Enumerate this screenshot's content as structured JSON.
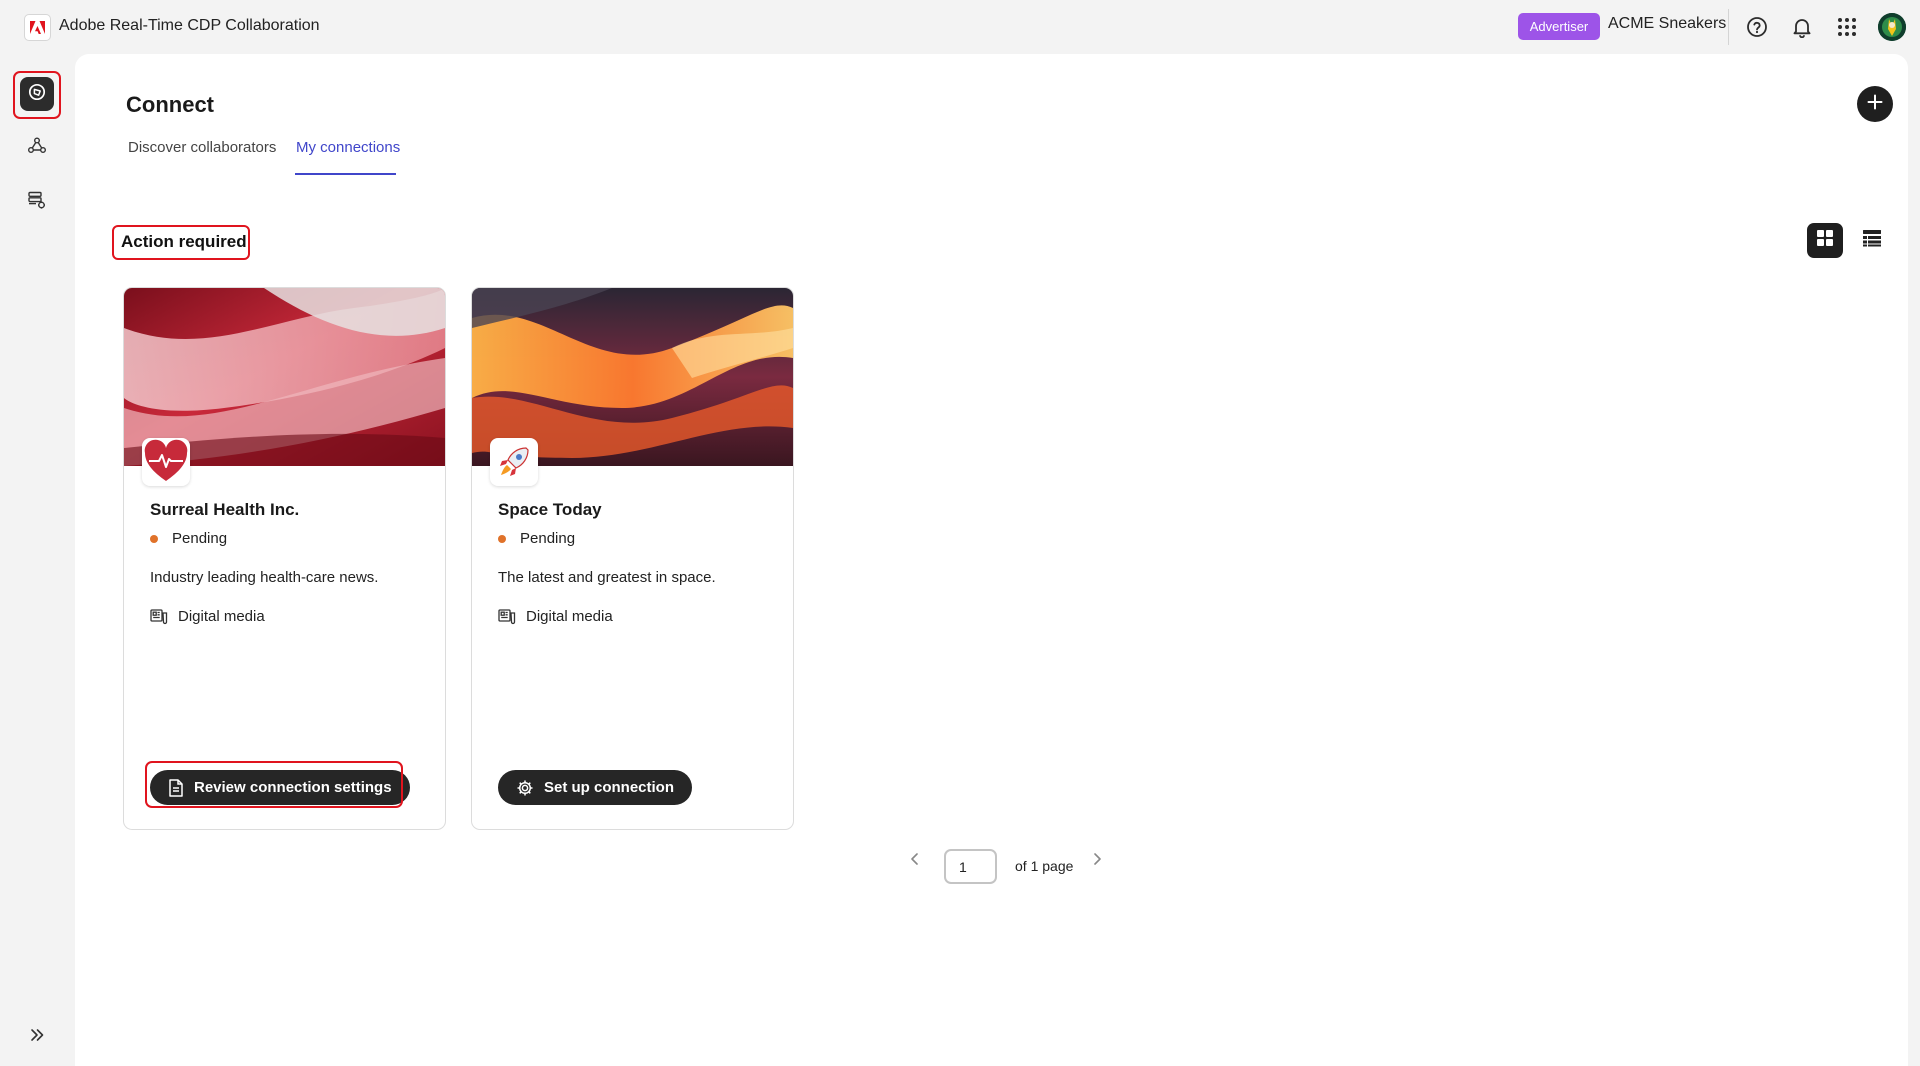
{
  "app": {
    "title": "Adobe Real-Time CDP Collaboration",
    "role_badge": "Advertiser",
    "org_name": "ACME Sneakers",
    "brand_color": "#e0141e"
  },
  "topbar": {
    "icons": [
      "help-icon",
      "bell-icon",
      "apps-grid-icon",
      "user-avatar"
    ]
  },
  "rail": {
    "items": [
      {
        "icon": "compass-icon",
        "active": true
      },
      {
        "icon": "collaborators-icon",
        "active": false
      },
      {
        "icon": "data-settings-icon",
        "active": false
      }
    ],
    "expand_icon": "expand-chevrons-icon"
  },
  "page": {
    "title": "Connect",
    "tabs": [
      {
        "label": "Discover collaborators",
        "selected": false
      },
      {
        "label": "My connections",
        "selected": true
      }
    ],
    "accent_color": "#4046ca"
  },
  "section": {
    "title": "Action required"
  },
  "cards": [
    {
      "name": "Surreal Health Inc.",
      "status": "Pending",
      "description": "Industry leading health-care news.",
      "category": "Digital media",
      "button": "Review connection settings",
      "logo_icon": "heart-pulse-icon"
    },
    {
      "name": "Space Today",
      "status": "Pending",
      "description": "The latest and greatest in space.",
      "category": "Digital media",
      "button": "Set up connection",
      "logo_icon": "rocket-icon"
    }
  ],
  "status_color": "#e0722a",
  "pagination": {
    "current": "1",
    "label": "of 1 page"
  }
}
